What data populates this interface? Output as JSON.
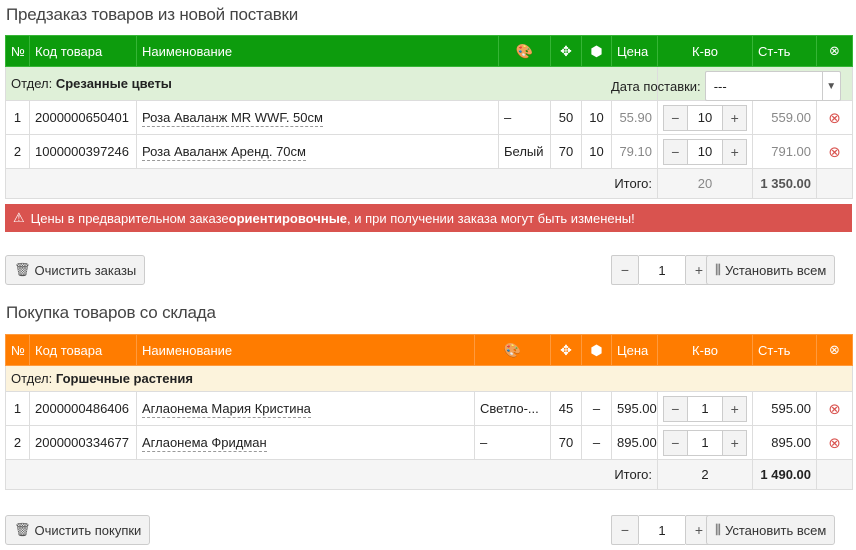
{
  "preorder": {
    "title": "Предзаказ товаров из новой поставки",
    "headers": {
      "num": "№",
      "code": "Код товара",
      "name": "Наименование",
      "price": "Цена",
      "qty": "К-во",
      "sum": "Ст-ть"
    },
    "section_label": "Отдел:",
    "section_name": "Срезанные цветы",
    "date_label": "Дата поставки:",
    "date_value": "---",
    "rows": [
      {
        "n": "1",
        "code": "2000000650401",
        "name": "Роза Аваланж MR WWF. 50см",
        "color": "–",
        "size": "50",
        "pack": "10",
        "price": "55.90",
        "qty": "10",
        "sum": "559.00"
      },
      {
        "n": "2",
        "code": "1000000397246",
        "name": "Роза Аваланж Аренд. 70см",
        "color": "Белый",
        "size": "70",
        "pack": "10",
        "price": "79.10",
        "qty": "10",
        "sum": "791.00"
      }
    ],
    "total_label": "Итого:",
    "total_qty": "20",
    "total_sum": "1 350.00",
    "warning_pre": "Цены в предварительном заказе ",
    "warning_bold": "ориентировочные",
    "warning_post": ", и при получении заказа могут быть изменены!",
    "clear_label": "Очистить заказы",
    "set_qty": "1",
    "set_all_label": "Установить всем"
  },
  "purchase": {
    "title": "Покупка товаров со склада",
    "headers": {
      "num": "№",
      "code": "Код товара",
      "name": "Наименование",
      "price": "Цена",
      "qty": "К-во",
      "sum": "Ст-ть"
    },
    "section_label": "Отдел:",
    "section_name": "Горшечные растения",
    "rows": [
      {
        "n": "1",
        "code": "2000000486406",
        "name": "Аглаонема Мария Кристина",
        "color": "Светло-...",
        "size": "45",
        "pack": "–",
        "price": "595.00",
        "qty": "1",
        "sum": "595.00"
      },
      {
        "n": "2",
        "code": "2000000334677",
        "name": "Аглаонема Фридман",
        "color": "–",
        "size": "70",
        "pack": "–",
        "price": "895.00",
        "qty": "1",
        "sum": "895.00"
      }
    ],
    "total_label": "Итого:",
    "total_qty": "2",
    "total_sum": "1 490.00",
    "clear_label": "Очистить покупки",
    "set_qty": "1",
    "set_all_label": "Установить всем"
  },
  "colors": {
    "preorder_header": "#0d9c0d",
    "purchase_header": "#ff7c00",
    "warning": "#d9534f",
    "delete": "#d9534f"
  }
}
